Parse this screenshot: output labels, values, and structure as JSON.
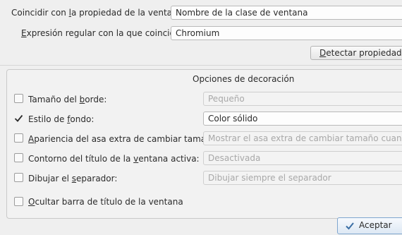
{
  "match": {
    "property_label_pre": "Coincidir con ",
    "property_label_u": "l",
    "property_label_post": "a propiedad de la ventana:",
    "property_value": "Nombre de la clase de ventana",
    "regex_label_pre": "",
    "regex_label_u": "E",
    "regex_label_post": "xpresión regular con la que coincidir:",
    "regex_value": "Chromium",
    "detect_button_pre": "",
    "detect_button_u": "D",
    "detect_button_post": "etectar propiedades"
  },
  "decoration": {
    "title": "Opciones de decoración",
    "rows": [
      {
        "label_pre": "Tamaño del ",
        "label_u": "b",
        "label_post": "orde:",
        "value": "Pequeño",
        "checked": false,
        "enabled": false
      },
      {
        "label_pre": "Estilo de ",
        "label_u": "f",
        "label_post": "ondo:",
        "value": "Color sólido",
        "checked": true,
        "enabled": true
      },
      {
        "label_pre": "",
        "label_u": "A",
        "label_post": "pariencia del asa extra de cambiar tamaño:",
        "value": "Mostrar el asa extra de cambiar tamaño cuando sea necesario",
        "checked": false,
        "enabled": false
      },
      {
        "label_pre": "Contorno del título de la ",
        "label_u": "v",
        "label_post": "entana activa:",
        "value": "Desactivada",
        "checked": false,
        "enabled": false
      },
      {
        "label_pre": "Dibujar el ",
        "label_u": "s",
        "label_post": "eparador:",
        "value": "Dibujar siempre el separador",
        "checked": false,
        "enabled": false
      }
    ],
    "hide_titlebar_pre": "",
    "hide_titlebar_u": "O",
    "hide_titlebar_post": "cultar barra de título de la ventana",
    "hide_titlebar_checked": false
  },
  "footer": {
    "accept_label": "Aceptar",
    "accept_icon": "checkmark-icon"
  }
}
